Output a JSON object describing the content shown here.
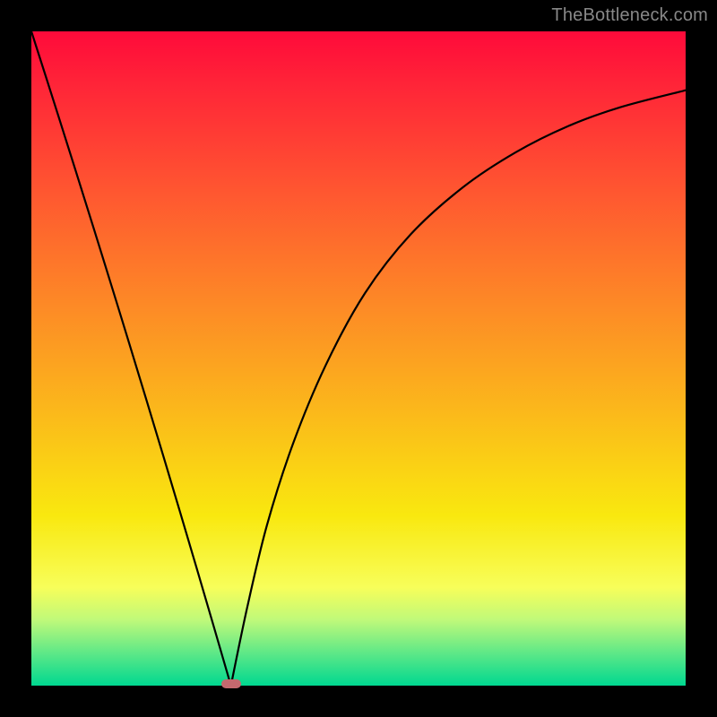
{
  "watermark": "TheBottleneck.com",
  "chart_data": {
    "type": "line",
    "title": "",
    "xlabel": "",
    "ylabel": "",
    "xlim": [
      0,
      1
    ],
    "ylim": [
      0,
      1
    ],
    "dip_x": 0.305,
    "left_branch": {
      "x0": 0.0,
      "y0": 1.0,
      "x1": 0.305,
      "y1": 0.0
    },
    "right_branch_points": [
      {
        "x": 0.305,
        "y": 0.0
      },
      {
        "x": 0.33,
        "y": 0.12
      },
      {
        "x": 0.36,
        "y": 0.245
      },
      {
        "x": 0.4,
        "y": 0.37
      },
      {
        "x": 0.45,
        "y": 0.49
      },
      {
        "x": 0.51,
        "y": 0.6
      },
      {
        "x": 0.58,
        "y": 0.69
      },
      {
        "x": 0.66,
        "y": 0.762
      },
      {
        "x": 0.74,
        "y": 0.815
      },
      {
        "x": 0.82,
        "y": 0.855
      },
      {
        "x": 0.9,
        "y": 0.884
      },
      {
        "x": 1.0,
        "y": 0.91
      }
    ],
    "dip_marker": {
      "x": 0.305,
      "y": 0.003
    }
  }
}
